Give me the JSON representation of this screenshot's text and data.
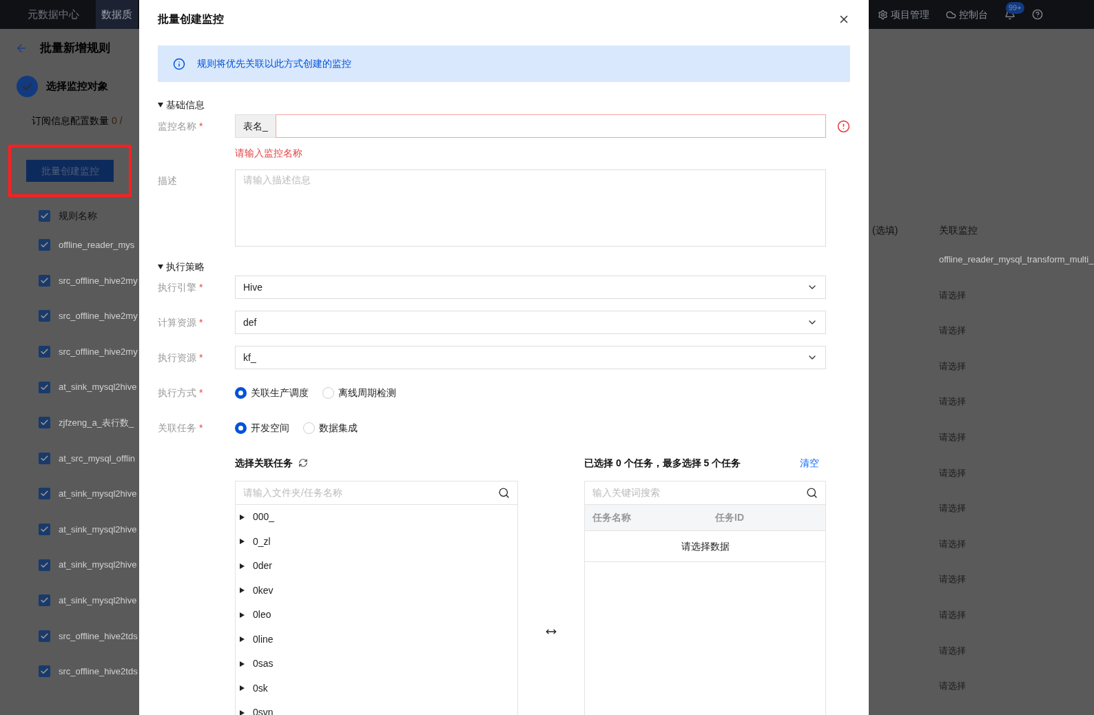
{
  "top_bar": {
    "nav": [
      {
        "label": "元数据中心",
        "selected": false
      },
      {
        "label": "数据质",
        "selected": true
      }
    ],
    "right_items": [
      {
        "kind": "project",
        "label": "项目管理"
      },
      {
        "kind": "console",
        "label": "控制台"
      }
    ],
    "notification_badge": "99+"
  },
  "page": {
    "title": "批量新增规则",
    "step": {
      "label": "选择监控对象",
      "done": true
    },
    "config_count_label": "订阅信息配置数量",
    "config_count": "0 /",
    "batch_button": "批量创建监控",
    "batch_button_highlighted": true,
    "table": {
      "header": {
        "label": "规则名称",
        "checked": true
      },
      "rows": [
        {
          "name": "offline_reader_mys",
          "checked": true
        },
        {
          "name": "src_offline_hive2my",
          "checked": true
        },
        {
          "name": "src_offline_hive2my",
          "checked": true
        },
        {
          "name": "src_offline_hive2my",
          "checked": true
        },
        {
          "name": "at_sink_mysql2hive",
          "checked": true
        },
        {
          "name": "zjfzeng_a_表行数_",
          "checked": true
        },
        {
          "name": "at_src_mysql_offlin",
          "checked": true
        },
        {
          "name": "at_sink_mysql2hive",
          "checked": true
        },
        {
          "name": "at_sink_mysql2hive",
          "checked": true
        },
        {
          "name": "at_sink_mysql2hive",
          "checked": true
        },
        {
          "name": "at_sink_mysql2hive",
          "checked": true
        },
        {
          "name": "src_offline_hive2tds",
          "checked": true
        },
        {
          "name": "src_offline_hive2tds",
          "checked": true
        }
      ],
      "right_columns": [
        "(选填)",
        "关联监控"
      ],
      "right_cells": [
        "offline_reader_mysql_transform_multi_",
        "请选择",
        "请选择",
        "请选择",
        "请选择",
        "请选择",
        "请选择",
        "请选择",
        "请选择",
        "请选择",
        "请选择",
        "请选择",
        "请选择"
      ]
    }
  },
  "dialog": {
    "title": "批量创建监控",
    "alert": "规则将优先关联以此方式创建的监控",
    "sections": [
      {
        "title": "基础信息",
        "expanded": true
      },
      {
        "title": "执行策略",
        "expanded": true
      }
    ],
    "name_field": {
      "label": "监控名称",
      "required_mark": "*",
      "prefix": "表名_",
      "error": "请输入监控名称"
    },
    "description": {
      "label": "描述",
      "placeholder": "请输入描述信息"
    },
    "selects": [
      {
        "label": "执行引擎",
        "required_mark": "*",
        "value": "Hive"
      },
      {
        "label": "计算资源",
        "required_mark": "*",
        "value": "def"
      },
      {
        "label": "执行资源",
        "required_mark": "*",
        "value": "kf_"
      }
    ],
    "radio_groups": [
      {
        "label": "执行方式",
        "required_mark": "*",
        "options": [
          {
            "label": "关联生产调度",
            "selected": true
          },
          {
            "label": "离线周期检测",
            "selected": false
          }
        ]
      },
      {
        "label": "关联任务",
        "required_mark": "*",
        "options": [
          {
            "label": "开发空间",
            "selected": true
          },
          {
            "label": "数据集成",
            "selected": false
          }
        ]
      }
    ],
    "task_picker": {
      "title": "选择关联任务",
      "search_placeholder": "请输入文件夹/任务名称",
      "tree": [
        {
          "label": "000_",
          "expanded": false
        },
        {
          "label": "0_zl",
          "expanded": false
        },
        {
          "label": "0der",
          "expanded": false
        },
        {
          "label": "0kev",
          "expanded": false
        },
        {
          "label": "0leo",
          "expanded": false
        },
        {
          "label": "0line",
          "expanded": false
        },
        {
          "label": "0sas",
          "expanded": false
        },
        {
          "label": "0sk",
          "expanded": false
        },
        {
          "label": "0svn",
          "expanded": false
        }
      ]
    },
    "selected_panel": {
      "summary": "已选择 0 个任务，最多选择 5 个任务",
      "clear": "清空",
      "search_placeholder": "输入关键词搜索",
      "columns": [
        "任务名称",
        "任务ID"
      ],
      "empty": "请选择数据"
    }
  }
}
